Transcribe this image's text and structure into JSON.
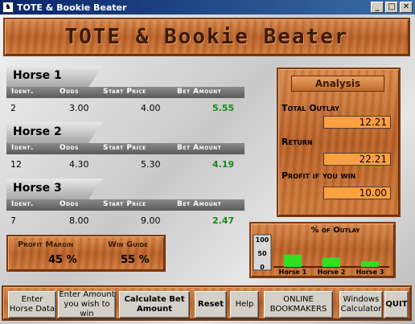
{
  "window": {
    "title": "TOTE & Bookie Beater"
  },
  "banner": {
    "title": "TOTE & Bookie Beater"
  },
  "headers": {
    "ident": "Ident.",
    "odds": "Odds",
    "start_price": "Start Price",
    "bet_amount": "Bet Amount"
  },
  "horses": [
    {
      "label": "Horse 1",
      "ident": "2",
      "odds": "3.00",
      "start_price": "4.00",
      "bet": "5.55"
    },
    {
      "label": "Horse 2",
      "ident": "12",
      "odds": "4.30",
      "start_price": "5.30",
      "bet": "4.19"
    },
    {
      "label": "Horse 3",
      "ident": "7",
      "odds": "8.00",
      "start_price": "9.00",
      "bet": "2.47"
    }
  ],
  "analysis": {
    "title": "Analysis",
    "total_outlay_label": "Total Outlay",
    "total_outlay": "12.21",
    "return_label": "Return",
    "return": "22.21",
    "profit_label": "Profit if you win",
    "profit": "10.00"
  },
  "summary": {
    "profit_margin_label": "Profit Margin",
    "profit_margin": "45 %",
    "win_guide_label": "Win Guide",
    "win_guide": "55 %"
  },
  "chart_data": {
    "type": "bar",
    "title": "% of Outlay",
    "categories": [
      "Horse 1",
      "Horse 2",
      "Horse 3"
    ],
    "values": [
      45,
      34,
      20
    ],
    "ylim": [
      0,
      100
    ],
    "yticks": [
      "100",
      "50",
      "0"
    ],
    "bar_color": "#33dd22"
  },
  "buttons": {
    "enter_horse": "Enter Horse Data",
    "enter_amount": "Enter Amount you wish to win",
    "calculate": "Calculate Bet Amount",
    "reset": "Reset",
    "help": "Help",
    "online": "ONLINE BOOKMAKERS",
    "calculator": "Windows Calculator",
    "quit": "QUIT"
  },
  "icons": {
    "app": "horse-app-icon",
    "minimize": "minimize-icon",
    "maximize": "maximize-icon",
    "close": "close-icon"
  }
}
